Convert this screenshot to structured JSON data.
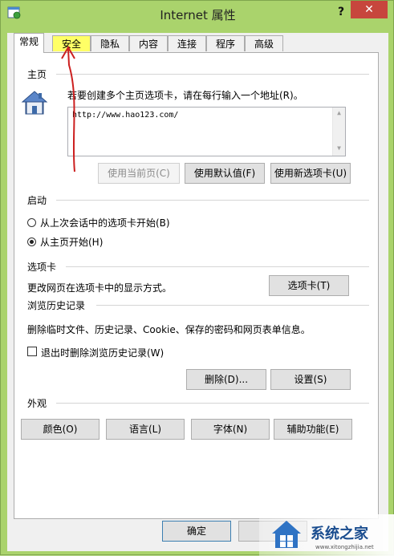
{
  "window": {
    "title": "Internet 属性",
    "help_label": "?",
    "close_label": "✕",
    "app_icon": "internet-options-icon"
  },
  "tabs": [
    "常规",
    "安全",
    "隐私",
    "内容",
    "连接",
    "程序",
    "高级"
  ],
  "active_tab": "常规",
  "highlighted_tab": "安全",
  "homepage": {
    "section_title": "主页",
    "instruction": "若要创建多个主页选项卡，请在每行输入一个地址(R)。",
    "url": "http://www.hao123.com/",
    "btn_current": "使用当前页(C)",
    "btn_default": "使用默认值(F)",
    "btn_newtab": "使用新选项卡(U)",
    "icon": "house-icon"
  },
  "startup": {
    "section_title": "启动",
    "option_last_session": "从上次会话中的选项卡开始(B)",
    "option_home": "从主页开始(H)",
    "selected": "option_home"
  },
  "tabs_section": {
    "section_title": "选项卡",
    "description": "更改网页在选项卡中的显示方式。",
    "button": "选项卡(T)"
  },
  "history": {
    "section_title": "浏览历史记录",
    "description": "删除临时文件、历史记录、Cookie、保存的密码和网页表单信息。",
    "checkbox_label": "退出时删除浏览历史记录(W)",
    "checkbox_checked": false,
    "btn_delete": "删除(D)...",
    "btn_settings": "设置(S)"
  },
  "appearance": {
    "section_title": "外观",
    "btn_colors": "颜色(O)",
    "btn_languages": "语言(L)",
    "btn_fonts": "字体(N)",
    "btn_accessibility": "辅助功能(E)"
  },
  "footer": {
    "ok": "确定"
  },
  "watermark": {
    "name": "系统之家",
    "url": "www.xitongzhijia.net"
  },
  "colors": {
    "frame": "#aad36c",
    "close": "#c7463d",
    "annotation": "#cc1f1f",
    "highlight": "#ffff66"
  }
}
